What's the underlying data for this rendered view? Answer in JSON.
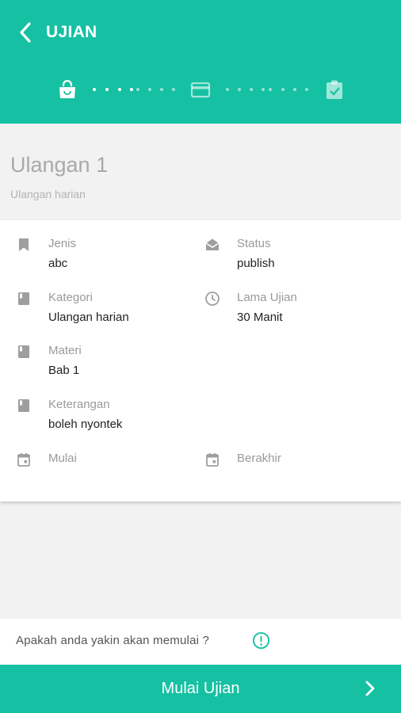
{
  "header": {
    "title": "UJIAN",
    "background_color": "#16c0a3",
    "back_icon": "chevron-left-icon"
  },
  "stepper": {
    "steps": [
      {
        "icon": "bag-icon",
        "active": true
      },
      {
        "icon": "credit-card-icon",
        "active": false
      },
      {
        "icon": "clipboard-check-icon",
        "active": false
      }
    ]
  },
  "exam": {
    "title": "Ulangan 1",
    "subtitle": "Ulangan harian"
  },
  "details": {
    "jenis": {
      "label": "Jenis",
      "value": "abc",
      "icon": "bookmark-icon"
    },
    "status": {
      "label": "Status",
      "value": "publish",
      "icon": "envelope-open-icon"
    },
    "kategori": {
      "label": "Kategori",
      "value": "Ulangan harian",
      "icon": "book-icon"
    },
    "lama_ujian": {
      "label": "Lama Ujian",
      "value": "30 Manit",
      "icon": "clock-icon"
    },
    "materi": {
      "label": "Materi",
      "value": "Bab 1",
      "icon": "book-icon"
    },
    "keterangan": {
      "label": "Keterangan",
      "value": "boleh nyontek",
      "icon": "book-icon"
    },
    "mulai": {
      "label": "Mulai",
      "value": "",
      "icon": "calendar-icon"
    },
    "berakhir": {
      "label": "Berakhir",
      "value": "",
      "icon": "calendar-icon"
    }
  },
  "confirm": {
    "text": "Apakah anda yakin akan memulai ?",
    "icon": "info-icon"
  },
  "start_button": {
    "label": "Mulai Ujian",
    "icon": "chevron-right-icon"
  }
}
